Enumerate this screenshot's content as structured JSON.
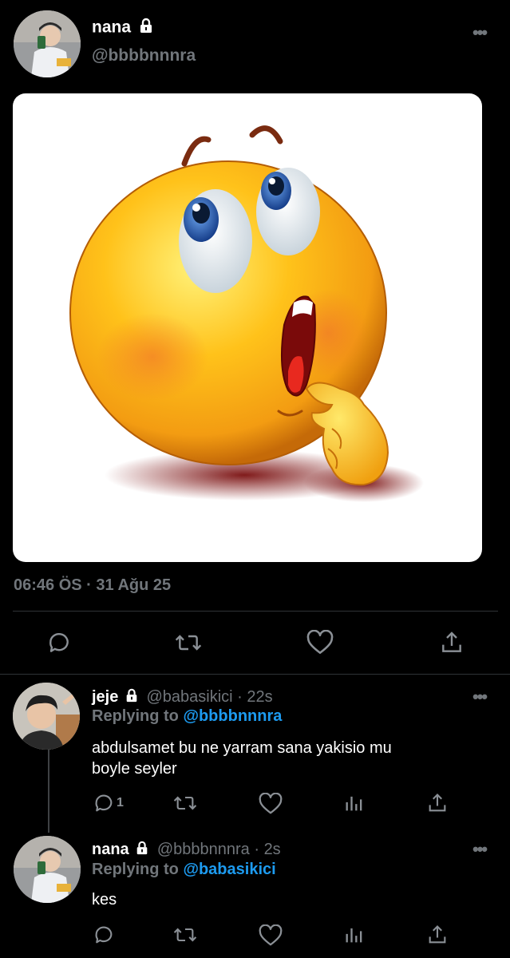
{
  "tweet": {
    "user": {
      "name": "nana",
      "handle": "@bbbbnnnra",
      "locked": true
    },
    "timestamp": "06:46 ÖS · 31 Ağu 25",
    "actions": [
      "reply-icon",
      "retweet-icon",
      "like-icon",
      "share-icon"
    ]
  },
  "replies": [
    {
      "user": {
        "name": "jeje",
        "handle": "@babasikici",
        "locked": true
      },
      "time": "22s",
      "replying_label": "Replying to",
      "replying_to": "@bbbbnnnra",
      "text_lines": [
        "abdulsamet bu ne yarram sana yakisio mu",
        "boyle seyler"
      ],
      "reply_count": "1"
    },
    {
      "user": {
        "name": "nana",
        "handle": "@bbbbnnnra",
        "locked": true
      },
      "time": "2s",
      "replying_label": "Replying to",
      "replying_to": "@babasikici",
      "text_lines": [
        "kes"
      ],
      "reply_count": ""
    }
  ],
  "colors": {
    "background": "#000000",
    "link": "#1d9bf0",
    "muted": "#71767b",
    "divider": "#2f3336"
  }
}
